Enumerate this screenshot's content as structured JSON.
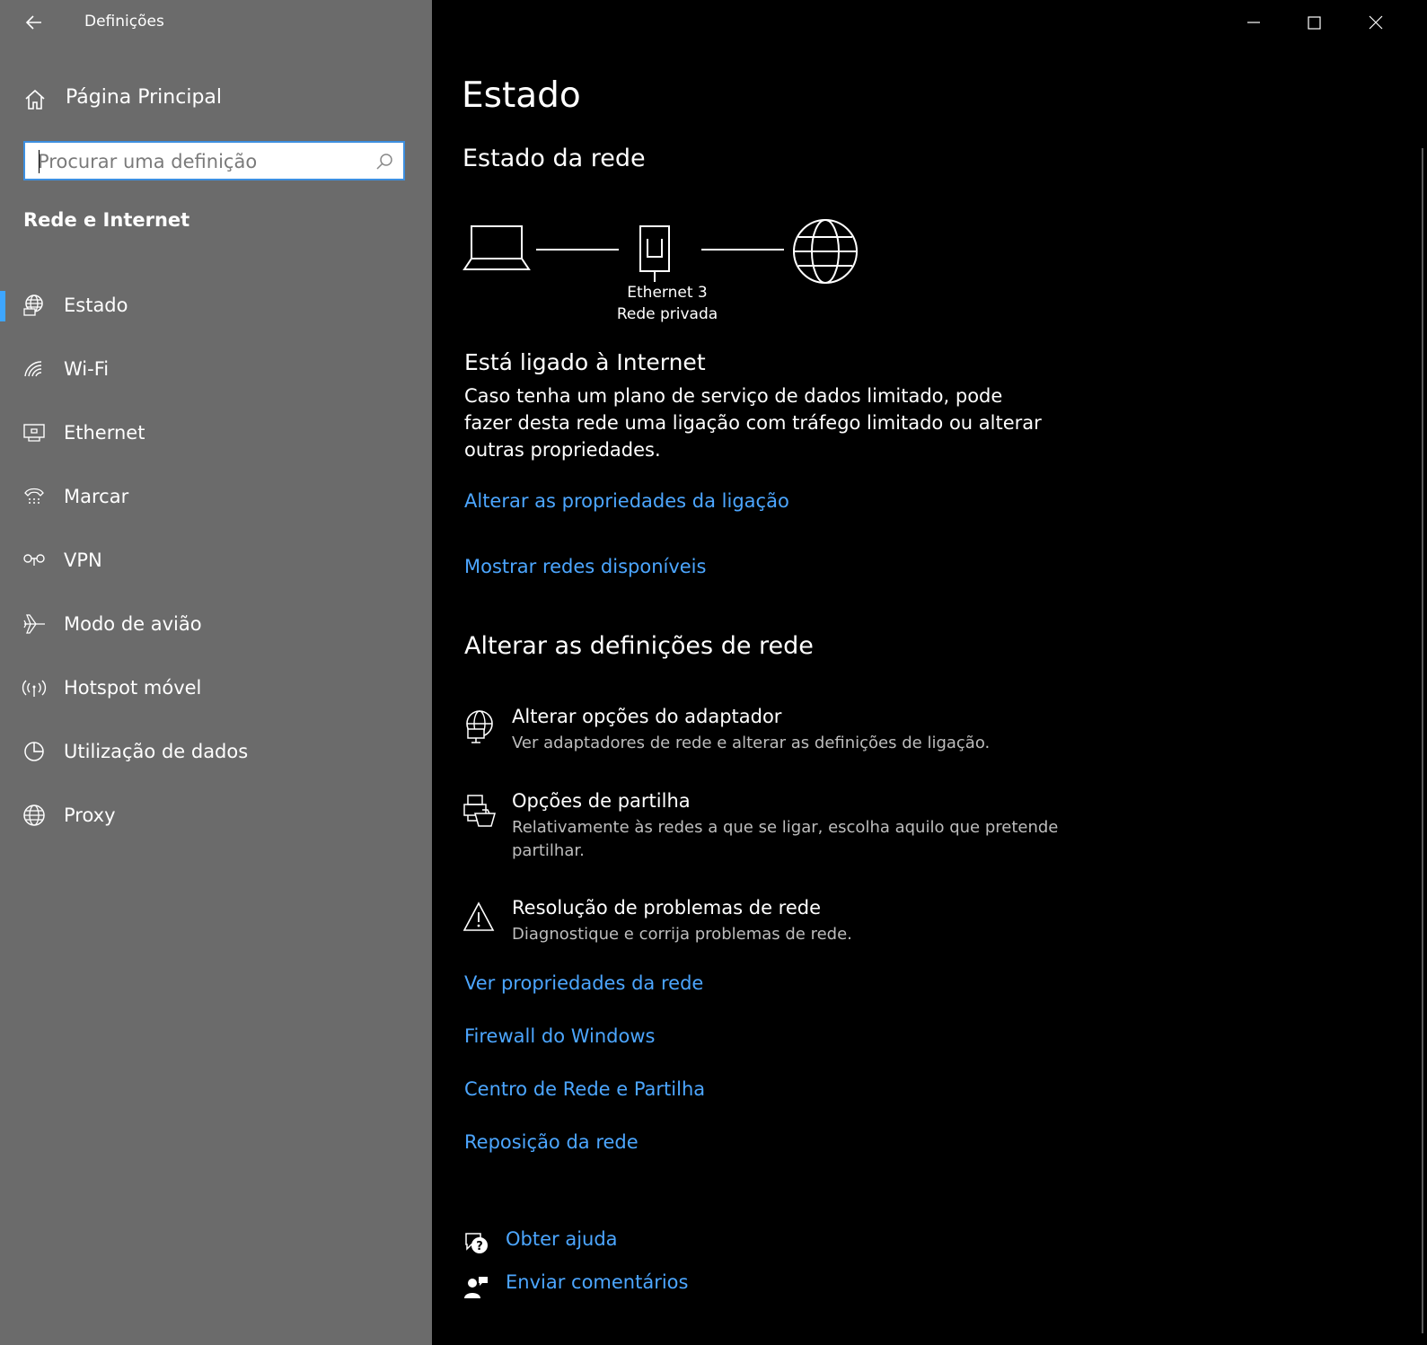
{
  "window": {
    "title": "Definições"
  },
  "sidebar": {
    "home_label": "Página Principal",
    "search_placeholder": "Procurar uma definição",
    "section_title": "Rede e Internet",
    "items": [
      {
        "label": "Estado",
        "icon": "globe-status-icon",
        "active": true
      },
      {
        "label": "Wi-Fi",
        "icon": "wifi-icon",
        "active": false
      },
      {
        "label": "Ethernet",
        "icon": "ethernet-icon",
        "active": false
      },
      {
        "label": "Marcar",
        "icon": "dialup-icon",
        "active": false
      },
      {
        "label": "VPN",
        "icon": "vpn-icon",
        "active": false
      },
      {
        "label": "Modo de avião",
        "icon": "airplane-icon",
        "active": false
      },
      {
        "label": "Hotspot móvel",
        "icon": "hotspot-icon",
        "active": false
      },
      {
        "label": "Utilização de dados",
        "icon": "data-usage-icon",
        "active": false
      },
      {
        "label": "Proxy",
        "icon": "proxy-globe-icon",
        "active": false
      }
    ]
  },
  "main": {
    "page_title": "Estado",
    "network_status_heading": "Estado da rede",
    "diagram": {
      "adapter_name": "Ethernet 3",
      "network_type": "Rede privada"
    },
    "connected_heading": "Está ligado à Internet",
    "connected_desc_line1": "Caso tenha um plano de serviço de dados limitado, pode",
    "connected_desc_line2": "fazer desta rede uma ligação com tráfego limitado ou alterar",
    "connected_desc_line3": "outras propriedades.",
    "link_change_props": "Alterar as propriedades da ligação",
    "link_show_networks": "Mostrar redes disponíveis",
    "change_settings_heading": "Alterar as definições de rede",
    "options": [
      {
        "title": "Alterar opções do adaptador",
        "desc_line1": "Ver adaptadores de rede e alterar as definições de ligação.",
        "desc_line2": "",
        "icon": "adapter-icon"
      },
      {
        "title": "Opções de partilha",
        "desc_line1": "Relativamente às redes a que se ligar, escolha aquilo que pretende",
        "desc_line2": "partilhar.",
        "icon": "sharing-icon"
      },
      {
        "title": "Resolução de problemas de rede",
        "desc_line1": "Diagnostique e corrija problemas de rede.",
        "desc_line2": "",
        "icon": "warning-icon"
      }
    ],
    "links": {
      "view_props": "Ver propriedades da rede",
      "firewall": "Firewall do Windows",
      "network_center": "Centro de Rede e Partilha",
      "reset": "Reposição da rede"
    },
    "help": {
      "get_help": "Obter ajuda",
      "feedback": "Enviar comentários"
    }
  },
  "colors": {
    "sidebar_bg": "#6b6b6b",
    "main_bg": "#000000",
    "accent": "#3ea6ff",
    "link": "#4ca6ff"
  }
}
